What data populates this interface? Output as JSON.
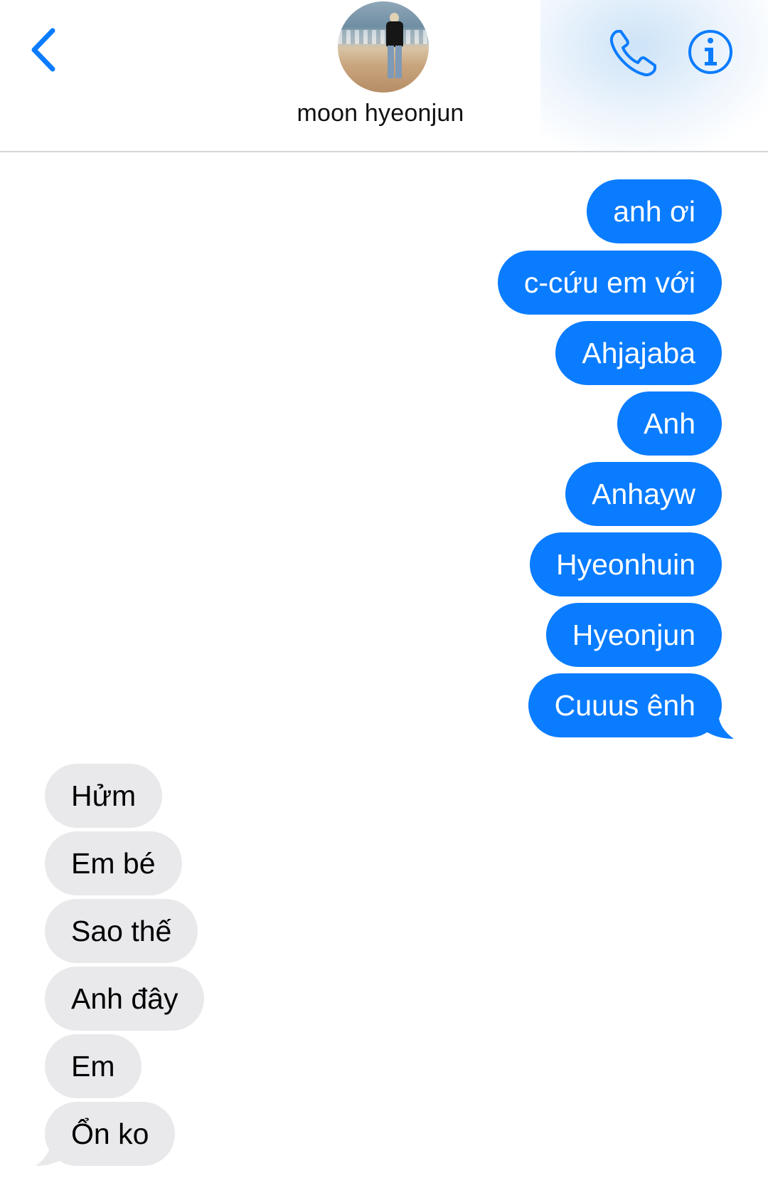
{
  "header": {
    "contact_name": "moon hyeonjun",
    "accent_color": "#0a7cff",
    "back_icon": "chevron-left-icon",
    "call_icon": "phone-icon",
    "info_icon": "info-icon"
  },
  "messages": {
    "sent": [
      "anh ơi",
      "c-cứu em với",
      "Ahjajaba",
      "Anh",
      "Anhayw",
      "Hyeonhuin",
      "Hyeonjun",
      "Cuuus ênh"
    ],
    "received": [
      "Hửm",
      "Em bé",
      "Sao thế",
      "Anh đây",
      "Em",
      "Ổn ko"
    ]
  },
  "colors": {
    "sent_bubble": "#0a7cff",
    "received_bubble": "#e9e9eb"
  }
}
